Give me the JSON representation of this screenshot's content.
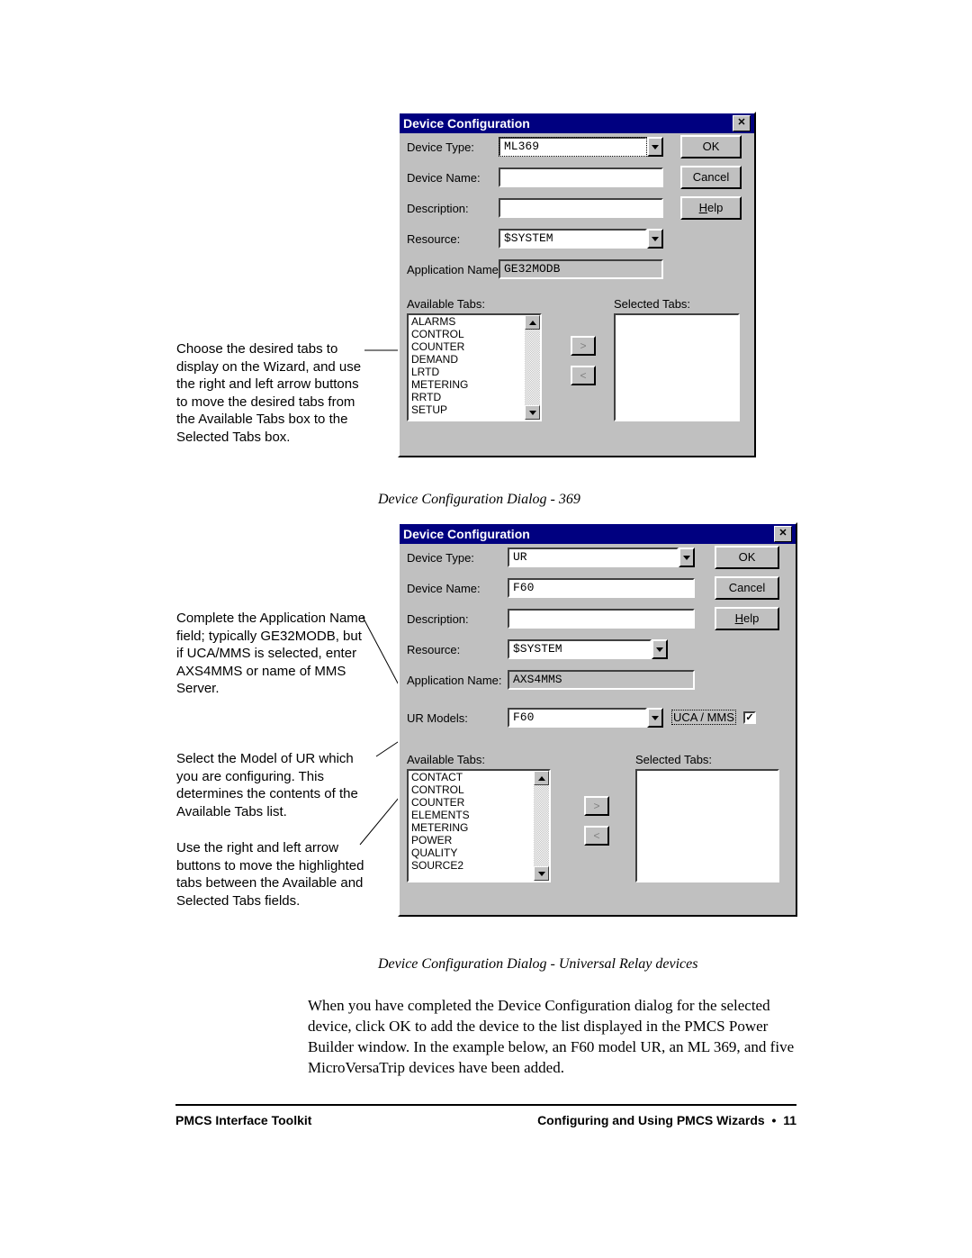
{
  "annotation1": "Choose the desired tabs to display on the Wizard, and use the right and left arrow buttons to move the desired tabs from the Available Tabs box to the Selected Tabs box.",
  "annotation2": "Complete the Application Name field; typically GE32MODB, but if UCA/MMS is selected, enter AXS4MMS or name of MMS Server.",
  "annotation3": "Select the Model of UR which you are configuring. This determines the contents of the Available Tabs list.",
  "annotation4": "Use the right and left arrow buttons to move the highlighted tabs between the Available and Selected Tabs fields.",
  "caption1": "Device Configuration Dialog - 369",
  "caption2": "Device Configuration Dialog - Universal Relay devices",
  "bodytext1": "When you have completed the Device Configuration dialog for the selected device, click OK to add the device to the list displayed in the PMCS Power Builder window. In the example below, an F60 model UR, an ML 369, and five MicroVersaTrip devices have been added.",
  "footer": {
    "left": "PMCS Interface Toolkit",
    "right_label": "Configuring and Using PMCS Wizards",
    "bullet": "•",
    "page": "11"
  },
  "dialog1": {
    "title": "Device Configuration",
    "close_glyph": "✕",
    "labels": {
      "device_type": "Device Type:",
      "device_name": "Device Name:",
      "description": "Description:",
      "resource": "Resource:",
      "application_name": "Application Name:",
      "available_tabs": "Available Tabs:",
      "selected_tabs": "Selected Tabs:"
    },
    "values": {
      "device_type": "ML369",
      "device_name": "",
      "description": "",
      "resource": "$SYSTEM",
      "application_name": "GE32MODB"
    },
    "available_tabs": [
      "ALARMS",
      "CONTROL",
      "COUNTER",
      "DEMAND",
      "LRTD",
      "METERING",
      "RRTD",
      "SETUP"
    ],
    "buttons": {
      "ok": "OK",
      "cancel": "Cancel",
      "help": "Help",
      "right": ">",
      "left": "<"
    }
  },
  "dialog2": {
    "title": "Device Configuration",
    "close_glyph": "✕",
    "labels": {
      "device_type": "Device Type:",
      "device_name": "Device Name:",
      "description": "Description:",
      "resource": "Resource:",
      "application_name": "Application Name:",
      "ur_models": "UR Models:",
      "uca_mms": "UCA / MMS",
      "available_tabs": "Available Tabs:",
      "selected_tabs": "Selected Tabs:"
    },
    "values": {
      "device_type": "UR",
      "device_name": "F60",
      "description": "",
      "resource": "$SYSTEM",
      "application_name": "AXS4MMS",
      "ur_models": "F60",
      "uca_mms_checked": "✓"
    },
    "available_tabs": [
      "CONTACT",
      "CONTROL",
      "COUNTER",
      "ELEMENTS",
      "METERING",
      "POWER",
      "QUALITY",
      "SOURCE2"
    ],
    "buttons": {
      "ok": "OK",
      "cancel": "Cancel",
      "help": "Help",
      "right": ">",
      "left": "<"
    }
  }
}
